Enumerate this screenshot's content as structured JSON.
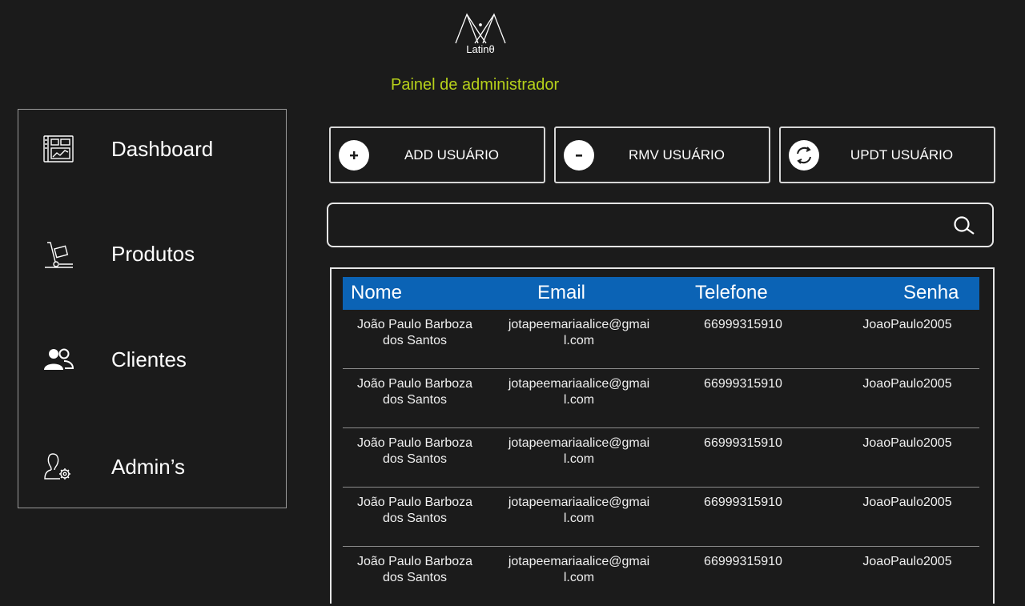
{
  "header": {
    "logo_text": "Latinθ",
    "panel_title": "Painel de administrador"
  },
  "sidebar": {
    "items": [
      {
        "label": "Dashboard",
        "icon": "dashboard-icon"
      },
      {
        "label": "Produtos",
        "icon": "hand-truck-icon"
      },
      {
        "label": "Clientes",
        "icon": "users-icon"
      },
      {
        "label": "Admin’s",
        "icon": "admin-gear-icon"
      }
    ]
  },
  "actions": {
    "add_label": "ADD USUÁRIO",
    "remove_label": "RMV USUÁRIO",
    "update_label": "UPDT USUÁRIO"
  },
  "search": {
    "value": "",
    "placeholder": ""
  },
  "table": {
    "headers": {
      "name": "Nome",
      "email": "Email",
      "phone": "Telefone",
      "password": "Senha"
    },
    "rows": [
      {
        "name": "João Paulo Barboza dos Santos",
        "email": "jotapeemariaalice@gmail.com",
        "phone": "66999315910",
        "password": "JoaoPaulo2005"
      },
      {
        "name": "João Paulo Barboza dos Santos",
        "email": "jotapeemariaalice@gmail.com",
        "phone": "66999315910",
        "password": "JoaoPaulo2005"
      },
      {
        "name": "João Paulo Barboza dos Santos",
        "email": "jotapeemariaalice@gmail.com",
        "phone": "66999315910",
        "password": "JoaoPaulo2005"
      },
      {
        "name": "João Paulo Barboza dos Santos",
        "email": "jotapeemariaalice@gmail.com",
        "phone": "66999315910",
        "password": "JoaoPaulo2005"
      },
      {
        "name": "João Paulo Barboza dos Santos",
        "email": "jotapeemariaalice@gmail.com",
        "phone": "66999315910",
        "password": "JoaoPaulo2005"
      }
    ]
  },
  "colors": {
    "background": "#1b1b1b",
    "accent_title": "#b7d11a",
    "table_header": "#0b63b5"
  }
}
